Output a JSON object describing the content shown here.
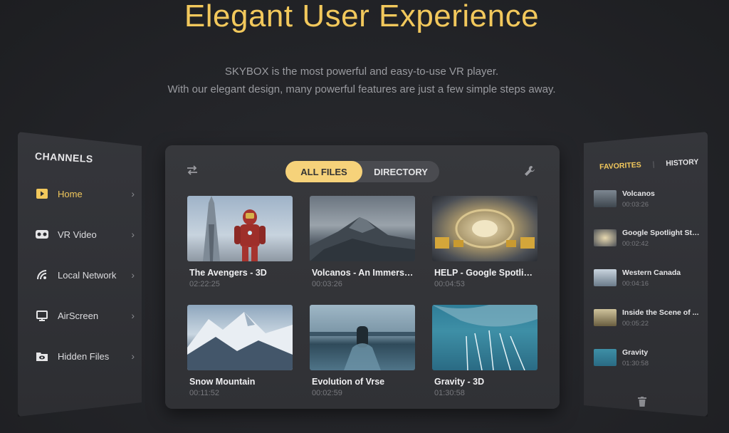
{
  "hero": {
    "title": "Elegant User Experience",
    "line1": "SKYBOX is the most powerful and easy-to-use VR player.",
    "line2": "With our elegant design, many powerful features are just a few simple steps away."
  },
  "colors": {
    "accent": "#f2c85c",
    "toggle_active": "#f6d27a"
  },
  "channels": {
    "title": "CHANNELS",
    "items": [
      {
        "label": "Home",
        "icon": "play-icon",
        "active": true
      },
      {
        "label": "VR Video",
        "icon": "vr-headset-icon"
      },
      {
        "label": "Local Network",
        "icon": "wifi-icon"
      },
      {
        "label": "AirScreen",
        "icon": "monitor-icon"
      },
      {
        "label": "Hidden Files",
        "icon": "hidden-folder-icon"
      }
    ]
  },
  "main": {
    "tabs": [
      {
        "label": "ALL FILES",
        "active": true
      },
      {
        "label": "DIRECTORY"
      }
    ],
    "cards": [
      {
        "title": "The Avengers - 3D",
        "duration": "02:22:25"
      },
      {
        "title": "Volcanos - An Immersive Experience",
        "duration": "00:03:26"
      },
      {
        "title": "HELP - Google Spotlight Story",
        "duration": "00:04:53"
      },
      {
        "title": "Snow Mountain",
        "duration": "00:11:52"
      },
      {
        "title": "Evolution of Vrse",
        "duration": "00:02:59"
      },
      {
        "title": "Gravity - 3D",
        "duration": "01:30:58"
      }
    ]
  },
  "sidebar_right": {
    "tabs": [
      {
        "label": "FAVORITES",
        "active": true
      },
      {
        "label": "HISTORY"
      }
    ],
    "items": [
      {
        "title": "Volcanos",
        "duration": "00:03:26"
      },
      {
        "title": "Google Spotlight Story",
        "duration": "00:02:42"
      },
      {
        "title": "Western Canada",
        "duration": "00:04:16"
      },
      {
        "title": "Inside the Scene of ...",
        "duration": "00:05:22"
      },
      {
        "title": "Gravity",
        "duration": "01:30:58"
      }
    ]
  }
}
